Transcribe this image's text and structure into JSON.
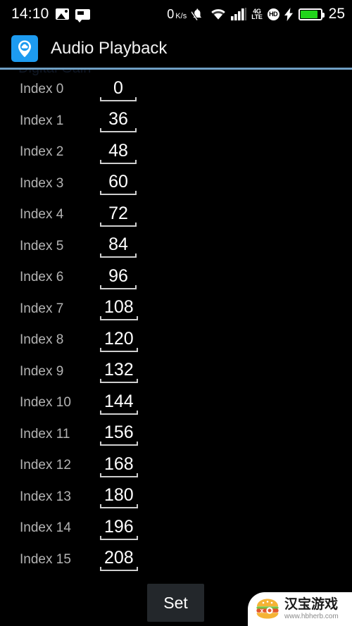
{
  "status_bar": {
    "time": "14:10",
    "left_icons": [
      "gallery-icon",
      "message-icon"
    ],
    "network_rate": "0",
    "network_rate_unit": "K/s",
    "icons": [
      "bell-muted-icon",
      "wifi-icon",
      "signal-bars-icon",
      "4g-lte-icon",
      "hd-icon",
      "charging-bolt-icon",
      "battery-icon"
    ],
    "lte_top": "4G",
    "lte_bottom": "LTE",
    "hd_label": "HD",
    "battery_percent": "25",
    "battery_fill_color": "#21d51b"
  },
  "header": {
    "app_title": "Audio Playback",
    "app_icon": "cloud-pin-icon",
    "icon_bg_color": "#1d9bf0",
    "divider_color": "#6f9fc4"
  },
  "content": {
    "scrolled_off_label": "Digital Gain",
    "rows": [
      {
        "label": "Index 0",
        "value": "0"
      },
      {
        "label": "Index 1",
        "value": "36"
      },
      {
        "label": "Index 2",
        "value": "48"
      },
      {
        "label": "Index 3",
        "value": "60"
      },
      {
        "label": "Index 4",
        "value": "72"
      },
      {
        "label": "Index 5",
        "value": "84"
      },
      {
        "label": "Index 6",
        "value": "96"
      },
      {
        "label": "Index 7",
        "value": "108"
      },
      {
        "label": "Index 8",
        "value": "120"
      },
      {
        "label": "Index 9",
        "value": "132"
      },
      {
        "label": "Index 10",
        "value": "144"
      },
      {
        "label": "Index 11",
        "value": "156"
      },
      {
        "label": "Index 12",
        "value": "168"
      },
      {
        "label": "Index 13",
        "value": "180"
      },
      {
        "label": "Index 14",
        "value": "196"
      },
      {
        "label": "Index 15",
        "value": "208"
      }
    ]
  },
  "bottom": {
    "set_label": "Set"
  },
  "watermark": {
    "title": "汉宝游戏",
    "url": "www.hbherb.com",
    "logo": "burger-icon"
  }
}
